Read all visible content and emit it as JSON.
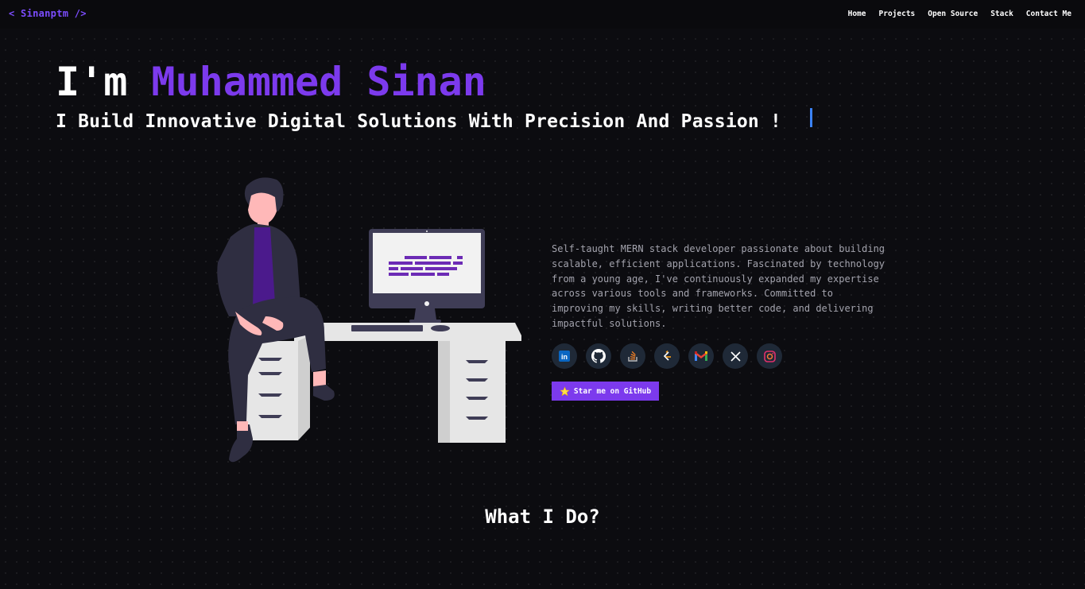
{
  "nav": {
    "logo": "< Sinanptm />",
    "links": [
      "Home",
      "Projects",
      "Open Source",
      "Stack",
      "Contact Me"
    ]
  },
  "hero": {
    "greeting": "I'm ",
    "name": "Muhammed Sinan",
    "tagline": "I Build Innovative Digital Solutions With Precision And Passion !"
  },
  "about": {
    "text": "Self-taught MERN stack developer passionate about building scalable, efficient applications. Fascinated by technology from a young age, I've continuously expanded my expertise across various tools and frameworks. Committed to improving my skills, writing better code, and delivering impactful solutions."
  },
  "socials": [
    "linkedin-icon",
    "github-icon",
    "stackoverflow-icon",
    "leetcode-icon",
    "gmail-icon",
    "x-icon",
    "instagram-icon"
  ],
  "cta": {
    "label": "Star me on GitHub",
    "icon": "star-icon"
  },
  "section": {
    "title": "What I Do?"
  },
  "colors": {
    "accent": "#7c3aed",
    "cursor": "#3b82f6",
    "background": "#0c0c10"
  }
}
